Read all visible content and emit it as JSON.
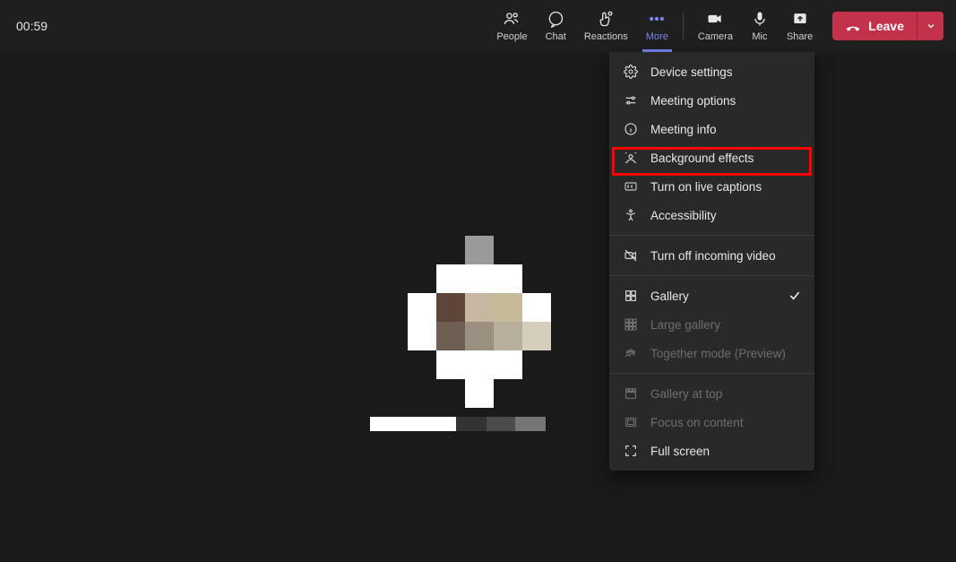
{
  "timer": "00:59",
  "toolbar": {
    "people_label": "People",
    "chat_label": "Chat",
    "reactions_label": "Reactions",
    "more_label": "More",
    "camera_label": "Camera",
    "mic_label": "Mic",
    "share_label": "Share",
    "leave_label": "Leave"
  },
  "more_menu": {
    "device_settings": "Device settings",
    "meeting_options": "Meeting options",
    "meeting_info": "Meeting info",
    "background_effects": "Background effects",
    "live_captions": "Turn on live captions",
    "accessibility": "Accessibility",
    "turn_off_incoming": "Turn off incoming video",
    "gallery": "Gallery",
    "large_gallery": "Large gallery",
    "together_mode": "Together mode (Preview)",
    "gallery_at_top": "Gallery at top",
    "focus_content": "Focus on content",
    "full_screen": "Full screen"
  },
  "highlight": "background_effects",
  "colors": {
    "accent": "#7c85f2",
    "danger": "#c4314b",
    "menu_bg": "#292929",
    "highlight_border": "#ff0000"
  }
}
